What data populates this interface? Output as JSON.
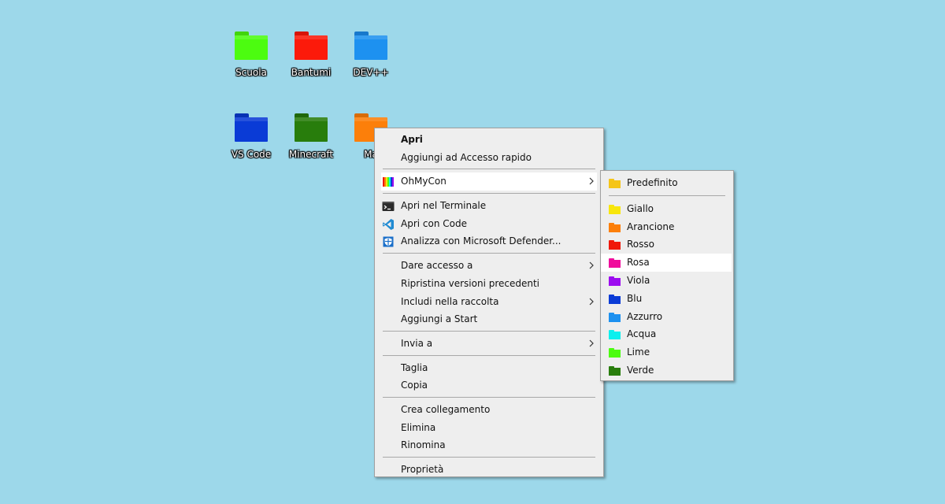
{
  "desktop": {
    "icons": [
      {
        "label": "Scuola",
        "color": "#4cfc10",
        "tab_color": "#42d40e"
      },
      {
        "label": "Bantumi",
        "color": "#fc1a0a",
        "tab_color": "#d81408"
      },
      {
        "label": "DEV++",
        "color": "#1d91f0",
        "tab_color": "#1878cc"
      },
      {
        "label": "VS Code",
        "color": "#0a3bd6",
        "tab_color": "#0832b4"
      },
      {
        "label": "Minecraft",
        "color": "#287d0c",
        "tab_color": "#20680a"
      },
      {
        "label": "Ma",
        "color": "#fc7f0a",
        "tab_color": "#d86c08"
      }
    ]
  },
  "context_menu": {
    "open": "Apri",
    "quick_access": "Aggiungi ad Accesso rapido",
    "ohmycon": "OhMyCon",
    "terminal": "Apri nel Terminale",
    "open_code": "Apri con Code",
    "defender": "Analizza con Microsoft Defender...",
    "give_access": "Dare accesso a",
    "restore_versions": "Ripristina versioni precedenti",
    "include_library": "Includi nella raccolta",
    "pin_start": "Aggiungi a Start",
    "send_to": "Invia a",
    "cut": "Taglia",
    "copy": "Copia",
    "create_shortcut": "Crea collegamento",
    "delete": "Elimina",
    "rename": "Rinomina",
    "properties": "Proprietà"
  },
  "submenu": {
    "default": {
      "label": "Predefinito",
      "color": "#f5c518"
    },
    "colors": [
      {
        "label": "Giallo",
        "color": "#f8e60c"
      },
      {
        "label": "Arancione",
        "color": "#fc7f0a"
      },
      {
        "label": "Rosso",
        "color": "#f0180a"
      },
      {
        "label": "Rosa",
        "color": "#f00c9c"
      },
      {
        "label": "Viola",
        "color": "#9c0cf0"
      },
      {
        "label": "Blu",
        "color": "#0a3bd6"
      },
      {
        "label": "Azzurro",
        "color": "#1d91f0"
      },
      {
        "label": "Acqua",
        "color": "#0cf0ee"
      },
      {
        "label": "Lime",
        "color": "#4cfc10"
      },
      {
        "label": "Verde",
        "color": "#287d0c"
      }
    ],
    "highlighted": "Rosa"
  }
}
